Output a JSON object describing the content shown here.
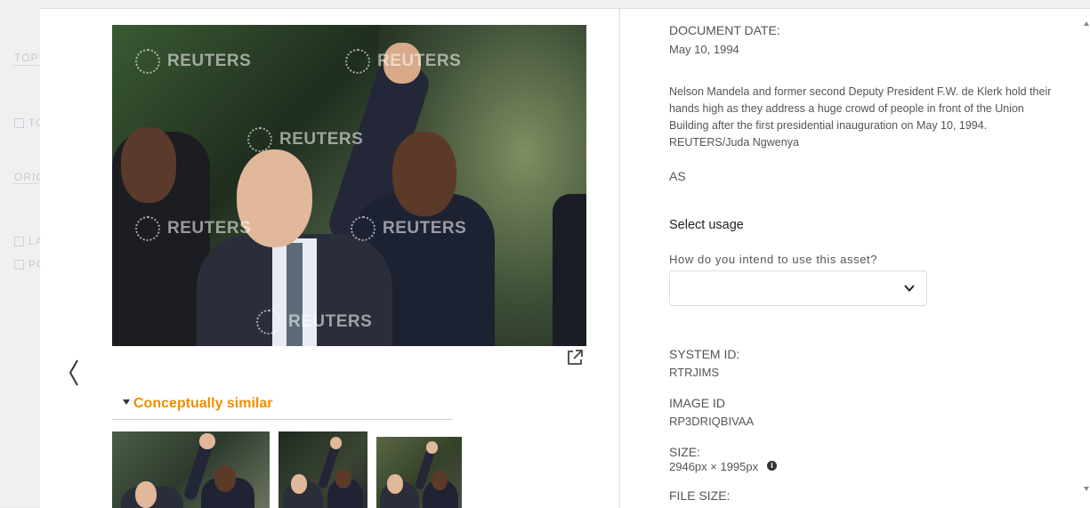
{
  "background": {
    "labels": [
      "TOP",
      "TO",
      "ORIG",
      "LA",
      "PO"
    ]
  },
  "media": {
    "watermark": "REUTERS",
    "alt": "Nelson Mandela and F.W. de Klerk holding hands high",
    "open_external_icon": "external-link-icon",
    "prev_icon": "chevron-left-icon"
  },
  "similar": {
    "title": "Conceptually similar",
    "caret_icon": "caret-down-icon"
  },
  "details": {
    "document_date_label": "DOCUMENT DATE:",
    "document_date": "May 10, 1994",
    "caption": "Nelson Mandela and former second Deputy President F.W. de Klerk hold their hands high as they address a huge crowd of people in front of the Union Building after the first presidential inauguration on May 10, 1994. REUTERS/Juda Ngwenya",
    "initials": "AS",
    "select_usage": "Select usage",
    "usage_question": "How do you intend to use this asset?",
    "usage_value": "",
    "system_id_label": "SYSTEM ID:",
    "system_id": "RTRJIMS",
    "image_id_label": "IMAGE ID",
    "image_id": "RP3DRIQBIVAA",
    "size_label": "SIZE:",
    "size": "2946px × 1995px",
    "file_size_label": "FILE SIZE:"
  },
  "colors": {
    "accent": "#ef8f00",
    "text": "#555555",
    "divider": "#d9d9d9"
  }
}
